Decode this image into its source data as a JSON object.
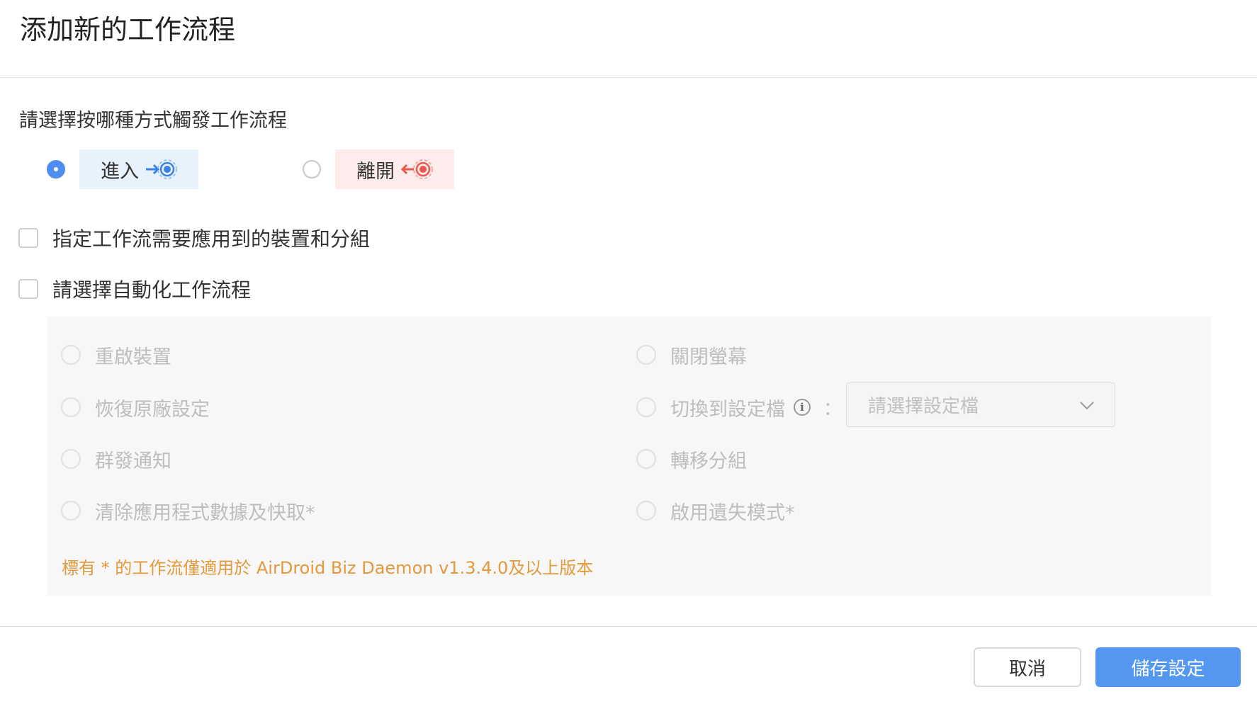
{
  "dialog": {
    "title": "添加新的工作流程"
  },
  "trigger": {
    "question": "請選擇按哪種方式觸發工作流程",
    "options": [
      {
        "label": "進入",
        "checked": true,
        "icon": "enter-geofence-icon",
        "color": "#3c82e6"
      },
      {
        "label": "離開",
        "checked": false,
        "icon": "leave-geofence-icon",
        "color": "#e8584f"
      }
    ]
  },
  "checkboxes": {
    "devices_label": "指定工作流需要應用到的裝置和分組",
    "automation_label": "請選擇自動化工作流程"
  },
  "actions": {
    "left": [
      "重啟裝置",
      "恢復原廠設定",
      "群發通知",
      "清除應用程式數據及快取*"
    ],
    "right": [
      "關閉螢幕",
      "切換到設定檔",
      "轉移分組",
      "啟用遺失模式*"
    ],
    "info_glyph": "i",
    "colon": "：",
    "profile_select_placeholder": "請選擇設定檔",
    "note": "標有 * 的工作流僅適用於 AirDroid Biz Daemon v1.3.4.0及以上版本"
  },
  "footer": {
    "cancel_label": "取消",
    "save_label": "儲存設定"
  },
  "colors": {
    "primary": "#5397f1",
    "note": "#e29a3d",
    "disabled_text": "#bdbdbd"
  }
}
